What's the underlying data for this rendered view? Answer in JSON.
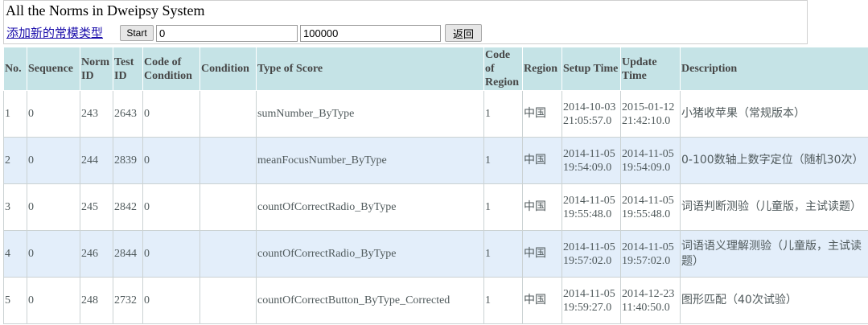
{
  "page": {
    "title": "All the Norms in Dweipsy System"
  },
  "toolbar": {
    "add_link": "添加新的常模类型",
    "start_label": "Start",
    "from_value": "0",
    "to_value": "100000",
    "back_label": "返回"
  },
  "table": {
    "headers": [
      "No.",
      "Sequence",
      "Norm ID",
      "Test ID",
      "Code of Condition",
      "Condition",
      "Type of Score",
      "Code of Region",
      "Region",
      "Setup Time",
      "Update Time",
      "Description"
    ],
    "rows": [
      [
        "1",
        "0",
        "243",
        "2643",
        "0",
        "",
        "sumNumber_ByType",
        "1",
        "中国",
        "2014-10-03 21:05:57.0",
        "2015-01-12 21:42:10.0",
        "小猪收苹果（常规版本）"
      ],
      [
        "2",
        "0",
        "244",
        "2839",
        "0",
        "",
        "meanFocusNumber_ByType",
        "1",
        "中国",
        "2014-11-05 19:54:09.0",
        "2014-11-05 19:54:09.0",
        "0-100数轴上数字定位（随机30次）"
      ],
      [
        "3",
        "0",
        "245",
        "2842",
        "0",
        "",
        "countOfCorrectRadio_ByType",
        "1",
        "中国",
        "2014-11-05 19:55:48.0",
        "2014-11-05 19:55:48.0",
        "词语判断测验（儿童版，主试读题）"
      ],
      [
        "4",
        "0",
        "246",
        "2844",
        "0",
        "",
        "countOfCorrectRadio_ByType",
        "1",
        "中国",
        "2014-11-05 19:57:02.0",
        "2014-11-05 19:57:02.0",
        "词语语义理解测验（儿童版，主试读题）"
      ],
      [
        "5",
        "0",
        "248",
        "2732",
        "0",
        "",
        "countOfCorrectButton_ByType_Corrected",
        "1",
        "中国",
        "2014-11-05 19:59:27.0",
        "2014-12-23 11:40:50.0",
        "图形匹配（40次试验）"
      ]
    ]
  }
}
